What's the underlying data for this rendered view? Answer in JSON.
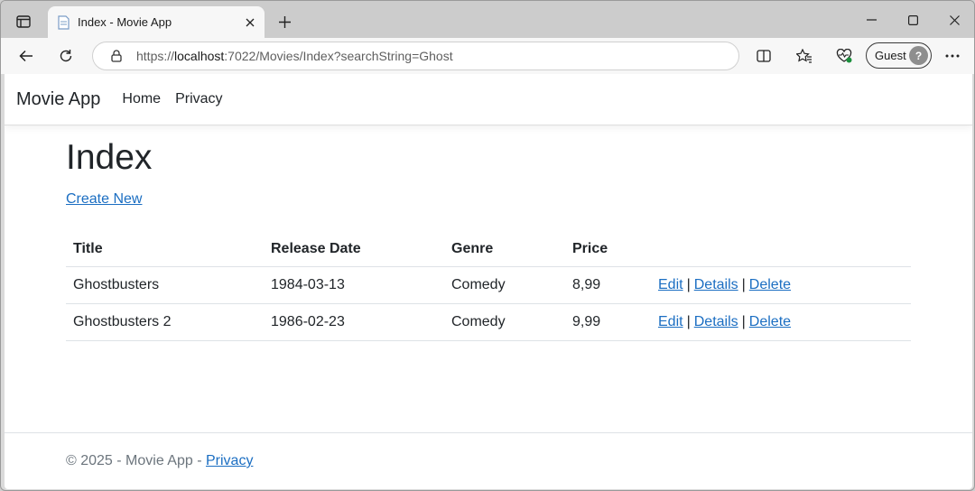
{
  "browser": {
    "tab_title": "Index - Movie App",
    "url_prefix": "https://",
    "url_host": "localhost",
    "url_rest": ":7022/Movies/Index?searchString=Ghost",
    "profile_label": "Guest"
  },
  "nav": {
    "brand": "Movie App",
    "home": "Home",
    "privacy": "Privacy"
  },
  "main": {
    "title": "Index",
    "create_new": "Create New",
    "columns": [
      "Title",
      "Release Date",
      "Genre",
      "Price"
    ],
    "rows": [
      {
        "title": "Ghostbusters",
        "release_date": "1984-03-13",
        "genre": "Comedy",
        "price": "8,99"
      },
      {
        "title": "Ghostbusters 2",
        "release_date": "1986-02-23",
        "genre": "Comedy",
        "price": "9,99"
      }
    ],
    "actions": {
      "edit": "Edit",
      "details": "Details",
      "delete": "Delete",
      "separator": "|"
    }
  },
  "footer": {
    "text": "© 2025 - Movie App - ",
    "privacy": "Privacy"
  },
  "colors": {
    "link": "#1b6ec2",
    "text": "#212529",
    "muted": "#6c757d"
  }
}
